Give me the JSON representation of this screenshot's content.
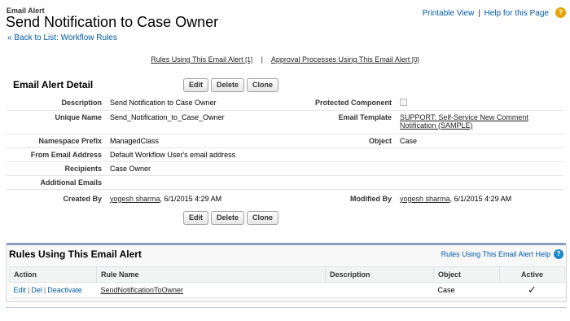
{
  "header": {
    "object_type": "Email Alert",
    "title": "Send Notification to Case Owner",
    "back_link": "« Back to List: Workflow Rules",
    "printable_view": "Printable View",
    "separator": "|",
    "help_link": "Help for this Page",
    "help_icon": "question-circle-icon"
  },
  "related_links": {
    "rules_label": "Rules Using This Email Alert",
    "rules_count": "[1]",
    "separator": "|",
    "approval_label": "Approval Processes Using This Email Alert",
    "approval_count": "[0]"
  },
  "detail": {
    "section_title": "Email Alert Detail",
    "buttons": {
      "edit": "Edit",
      "delete": "Delete",
      "clone": "Clone"
    },
    "fields": {
      "description_label": "Description",
      "description_value": "Send Notification to Case Owner",
      "protected_label": "Protected Component",
      "protected_value": false,
      "unique_name_label": "Unique Name",
      "unique_name_value": "Send_Notification_to_Case_Owner",
      "email_template_label": "Email Template",
      "email_template_value": "SUPPORT: Self-Service New Comment Notification (SAMPLE)",
      "namespace_label": "Namespace Prefix",
      "namespace_value": "ManagedClass",
      "object_label": "Object",
      "object_value": "Case",
      "from_email_label": "From Email Address",
      "from_email_value": "Default Workflow User's email address",
      "recipients_label": "Recipients",
      "recipients_value": "Case Owner",
      "additional_emails_label": "Additional Emails",
      "additional_emails_value": "",
      "created_by_label": "Created By",
      "created_by_user": "yogesh sharma",
      "created_by_date": ", 6/1/2015 4:29 AM",
      "modified_by_label": "Modified By",
      "modified_by_user": "yogesh sharma",
      "modified_by_date": ", 6/1/2015 4:29 AM"
    }
  },
  "related_list": {
    "title": "Rules Using This Email Alert",
    "help_link": "Rules Using This Email Alert Help",
    "help_icon": "question-circle-icon",
    "columns": [
      "Action",
      "Rule Name",
      "Description",
      "Object",
      "Active"
    ],
    "rows": [
      {
        "actions": [
          "Edit",
          "Del",
          "Deactivate"
        ],
        "rule_name": "SendNotificationToOwner",
        "description": "",
        "object": "Case",
        "active": "✓"
      }
    ]
  },
  "colors": {
    "link": "#015ba7",
    "section_border": "#8a9ebe",
    "help_icon": "#e8a100"
  }
}
